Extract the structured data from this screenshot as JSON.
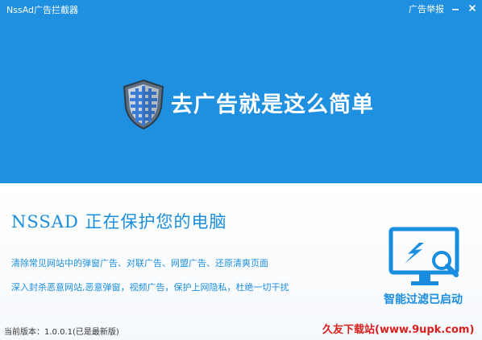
{
  "window": {
    "title": "NssAd广告拦截器",
    "report_link": "广告举报",
    "minimize_icon": "minimize-icon",
    "close_icon": "close-icon"
  },
  "hero": {
    "icon": "shield-icon",
    "slogan": "去广告就是这么简单"
  },
  "content": {
    "status_title": "NSSAD 正在保护您的电脑",
    "features": [
      "清除常见网站中的弹窗广告、对联广告、网盟广告、还原清爽页面",
      "深入封杀恶意网站,恶意弹窗，视频广告，保护上网隐私，杜绝一切干扰"
    ],
    "filter_icon": "monitor-search-icon",
    "filter_status": "智能过滤已启动"
  },
  "footer": {
    "version_label": "当前版本：",
    "version_value": "1.0.0.1(已是最新版)",
    "watermark": "久友下载站(www.9upk.com)"
  },
  "colors": {
    "banner_blue": "#1f8fe0",
    "text_blue": "#1a8de0",
    "watermark_red": "#d81e1e"
  }
}
